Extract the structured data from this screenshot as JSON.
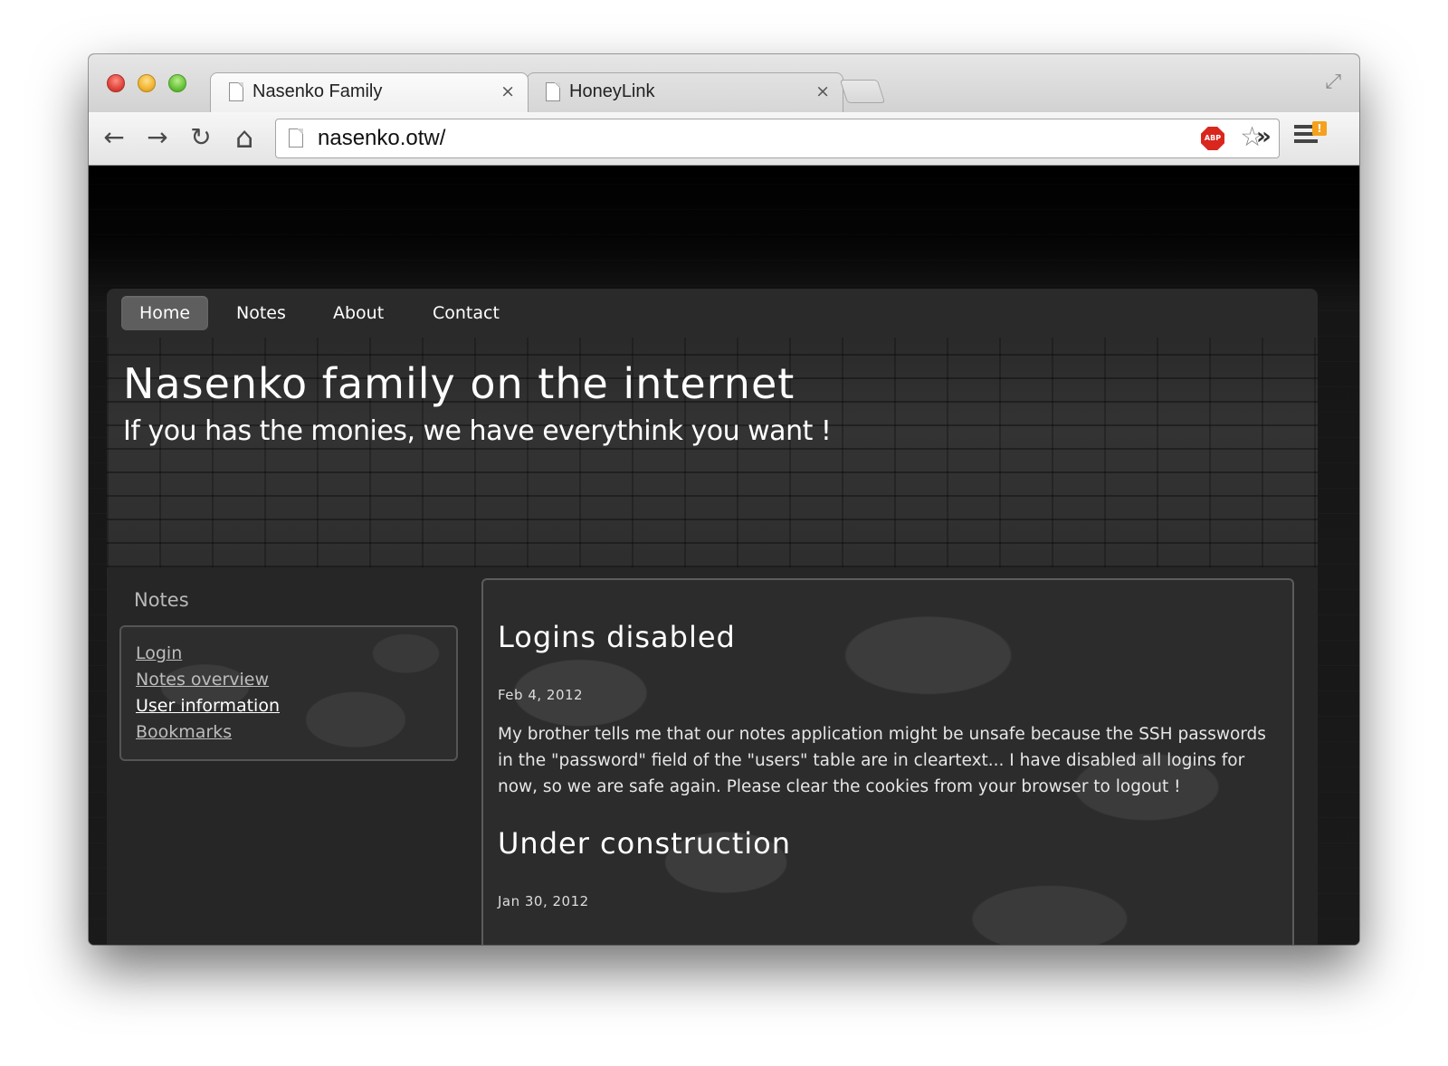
{
  "browser": {
    "tabs": [
      {
        "title": "Nasenko Family",
        "close": "×"
      },
      {
        "title": "HoneyLink",
        "close": "×"
      }
    ],
    "toolbar": {
      "back": "←",
      "forward": "→",
      "reload": "↻",
      "home": "⌂",
      "url": "nasenko.otw/",
      "abp_label": "ABP",
      "star": "☆",
      "extensions": "»",
      "warn": "!"
    },
    "fullscreen": "⤢"
  },
  "site": {
    "nav": [
      "Home",
      "Notes",
      "About",
      "Contact"
    ],
    "title": "Nasenko family on the internet",
    "subtitle": "If you has the monies, we have everythink you want !",
    "sidebar": {
      "title": "Notes",
      "links": [
        {
          "label": "Login",
          "color": "#bdbdbd"
        },
        {
          "label": "Notes overview",
          "color": "#bdbdbd"
        },
        {
          "label": "User information",
          "color": "#ffffff"
        },
        {
          "label": "Bookmarks",
          "color": "#bdbdbd"
        }
      ]
    },
    "posts": [
      {
        "title": "Logins disabled",
        "date": "Feb 4, 2012",
        "body": "My brother tells me that our notes application might be unsafe because the SSH passwords in the \"password\" field of the \"users\" table are in cleartext... I have disabled all logins for now, so we are safe again. Please clear the cookies from your browser to logout !"
      },
      {
        "title": "Under construction",
        "date": "Jan 30, 2012"
      }
    ]
  }
}
